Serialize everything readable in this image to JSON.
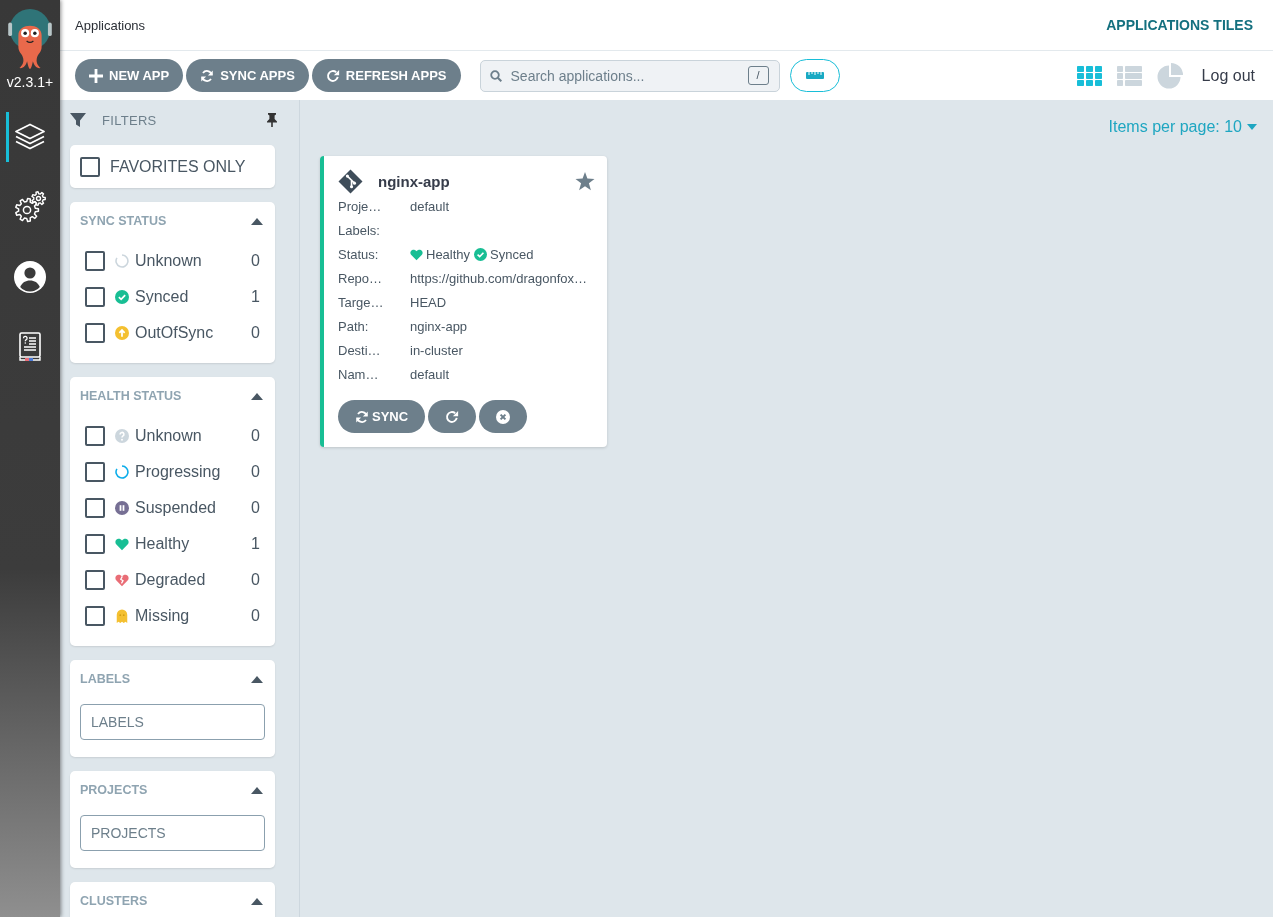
{
  "sidebar": {
    "version": "v2.3.1+",
    "nav": [
      {
        "kind": "applications",
        "selected": true
      },
      {
        "kind": "settings",
        "selected": false
      },
      {
        "kind": "user",
        "selected": false
      },
      {
        "kind": "docs",
        "selected": false
      }
    ]
  },
  "header": {
    "title": "Applications",
    "view_title": "APPLICATIONS TILES"
  },
  "toolbar": {
    "buttons": [
      {
        "kind": "add",
        "label": "NEW APP"
      },
      {
        "kind": "sync",
        "label": "SYNC APPS"
      },
      {
        "kind": "refresh",
        "label": "REFRESH APPS"
      }
    ],
    "search": {
      "placeholder": "Search applications...",
      "shortcut": "/"
    },
    "views": [
      {
        "kind": "tiles",
        "selected": true
      },
      {
        "kind": "list",
        "selected": false
      },
      {
        "kind": "summary",
        "selected": false
      }
    ],
    "logout": "Log out"
  },
  "filters": {
    "title": "FILTERS",
    "favorites": {
      "label": "FAVORITES ONLY",
      "checked": false
    },
    "panels": [
      {
        "kind": "checklist",
        "title": "SYNC STATUS",
        "expanded": true,
        "items": [
          {
            "kind": "sync-unknown",
            "label": "Unknown",
            "count": "0",
            "checked": false
          },
          {
            "kind": "synced",
            "label": "Synced",
            "count": "1",
            "checked": false
          },
          {
            "kind": "out-of-sync",
            "label": "OutOfSync",
            "count": "0",
            "checked": false
          }
        ]
      },
      {
        "kind": "checklist",
        "title": "HEALTH STATUS",
        "expanded": true,
        "items": [
          {
            "kind": "health-unknown",
            "label": "Unknown",
            "count": "0",
            "checked": false
          },
          {
            "kind": "progressing",
            "label": "Progressing",
            "count": "0",
            "checked": false
          },
          {
            "kind": "suspended",
            "label": "Suspended",
            "count": "0",
            "checked": false
          },
          {
            "kind": "healthy",
            "label": "Healthy",
            "count": "1",
            "checked": false
          },
          {
            "kind": "degraded",
            "label": "Degraded",
            "count": "0",
            "checked": false
          },
          {
            "kind": "missing",
            "label": "Missing",
            "count": "0",
            "checked": false
          }
        ]
      },
      {
        "kind": "input",
        "title": "LABELS",
        "expanded": true,
        "placeholder": "LABELS"
      },
      {
        "kind": "input",
        "title": "PROJECTS",
        "expanded": true,
        "placeholder": "PROJECTS"
      },
      {
        "kind": "input",
        "title": "CLUSTERS",
        "expanded": true
      }
    ]
  },
  "main": {
    "items_per_page": "Items per page: 10",
    "apps": [
      {
        "name": "nginx-app",
        "favorite": false,
        "fields": [
          {
            "kind": "text",
            "label": "Proje…",
            "value": "default"
          },
          {
            "kind": "text",
            "label": "Labels:"
          },
          {
            "kind": "status",
            "label": "Status:",
            "health": {
              "kind": "healthy",
              "label": "Healthy"
            },
            "sync": {
              "kind": "synced",
              "label": "Synced"
            }
          },
          {
            "kind": "text",
            "label": "Repo…",
            "value": "https://github.com/dragonfox…"
          },
          {
            "kind": "text",
            "label": "Targe…",
            "value": "HEAD"
          },
          {
            "kind": "text",
            "label": "Path:",
            "value": "nginx-app"
          },
          {
            "kind": "text",
            "label": "Desti…",
            "value": "in-cluster"
          },
          {
            "kind": "text",
            "label": "Nam…",
            "value": "default"
          }
        ],
        "actions": [
          {
            "kind": "sync",
            "label": "SYNC"
          },
          {
            "kind": "refresh"
          },
          {
            "kind": "delete"
          }
        ]
      }
    ]
  }
}
